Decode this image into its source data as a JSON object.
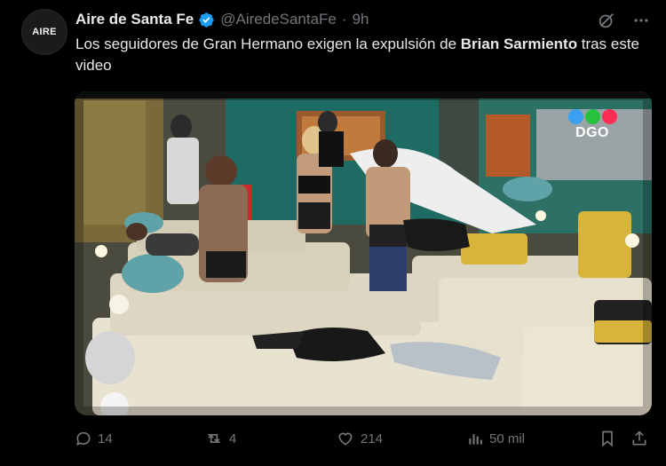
{
  "author": {
    "avatar_text": "AIRE",
    "name": "Aire de Santa Fe",
    "handle": "@AiredeSantaFe",
    "separator": "·",
    "time": "9h"
  },
  "tweet": {
    "text_before": "Los seguidores de Gran Hermano exigen la expulsión de ",
    "text_bold": "Brian Sarmiento",
    "text_after": " tras este video"
  },
  "media": {
    "logo_text": "DGO",
    "logo_colors": [
      "#3aa0f0",
      "#27c23d",
      "#ff2d55"
    ]
  },
  "actions": {
    "replies": "14",
    "reposts": "4",
    "likes": "214",
    "views": "50 mil"
  },
  "colors": {
    "background": "#000000",
    "text": "#e7e9ea",
    "muted": "#71767b",
    "verified": "#1d9bf0"
  },
  "icons": [
    "verified-icon",
    "grok-icon",
    "more-icon",
    "reply-icon",
    "repost-icon",
    "like-icon",
    "views-icon",
    "bookmark-icon",
    "share-icon"
  ]
}
